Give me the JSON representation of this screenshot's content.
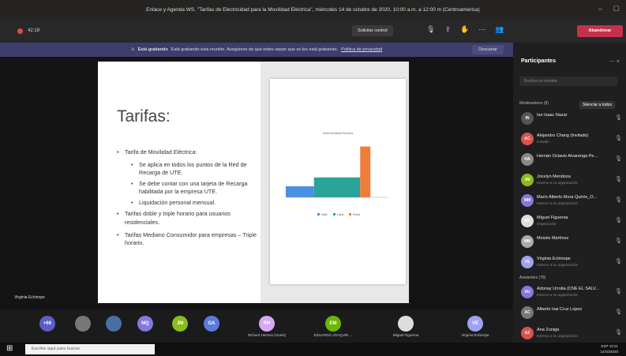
{
  "window": {
    "title": "Enlace y Agenda WS. \"Tarifas de Electricidad para la Movilidad Eléctrica\", miércoles 14 de octubre de 2020, 10:00 a.m. a 12:00 m (Centroamérica)"
  },
  "toolbar": {
    "timer": "42:19",
    "request_control": "Solicitar control",
    "leave": "Abandonar"
  },
  "banner": {
    "bold": "Está grabando",
    "text": "Está grabando esta reunión. Asegúrese de que todos sepan que se les está grabando.",
    "link": "Política de privacidad",
    "dismiss": "Descartar"
  },
  "slide": {
    "title": "Tarifas:",
    "bullets": [
      "Tarifa de Movilidad Eléctrica:",
      "Se aplica en todos los puntos de la Red de Recarga de UTE.",
      "Se debe contar con una tarjeta de Recarga habilitada por la empresa UTE.",
      "Liquidación personal mensual.",
      "Tarifas doble y triple horario para usuarios residenciales.",
      "Tarifas Mediano Consumidor para empresas – Triple horario."
    ]
  },
  "speaker_label": "Virginia Echinope",
  "chart_data": {
    "type": "bar",
    "title": "Tarifa Movilidad Eléctrica",
    "subtitle": "",
    "series": [
      {
        "name": "Valle",
        "color": "#4a90e2",
        "segment": [
          0,
          11
        ],
        "value": 1.0
      },
      {
        "name": "Llano",
        "color": "#2aa39a",
        "segment": [
          11,
          29
        ],
        "value": 1.8
      },
      {
        "name": "Punta",
        "color": "#f07c3a",
        "segment": [
          29,
          33
        ],
        "value": 4.6
      }
    ],
    "ylim": [
      0,
      5
    ],
    "xlim": [
      0,
      40
    ]
  },
  "stage_participants": [
    {
      "initials": "+66",
      "color": "#5b5fc7",
      "label": ""
    },
    {
      "initials": "",
      "color": "#777777",
      "label": ""
    },
    {
      "initials": "",
      "color": "#4a6fa5",
      "label": ""
    },
    {
      "initials": "MQ",
      "color": "#8378de",
      "label": ""
    },
    {
      "initials": "JM",
      "color": "#8cbd18",
      "label": ""
    },
    {
      "initials": "GA",
      "color": "#5c7bd9",
      "label": ""
    },
    {
      "initials": "RH",
      "color": "#d5a9f3",
      "label": "Richard Herrera (Guest)"
    },
    {
      "initials": "EM",
      "color": "#6bb700",
      "label": "EDUARDO JOAQUÍN ..."
    },
    {
      "initials": "",
      "color": "#dddddd",
      "label": "Miguel Figueroa"
    },
    {
      "initials": "VE",
      "color": "#9ea2f2",
      "label": "Virginia Echinope"
    }
  ],
  "panel": {
    "title": "Participantes",
    "invite_placeholder": "Escriba un nombre",
    "moderators_header": "Moderadores (8)",
    "mute_all": "Silenciar a todos",
    "attendees_header": "Asistentes (78)",
    "moderators": [
      {
        "initials": "IN",
        "color": "#555",
        "name": "Ian Isaac Nazar",
        "sub": ""
      },
      {
        "initials": "AC",
        "color": "#d9534f",
        "name": "Alejandro Chang (Invitado)",
        "sub": "Invitado"
      },
      {
        "initials": "HA",
        "color": "#888",
        "name": "Hernán Octavio Alvarenga Pe...",
        "sub": ""
      },
      {
        "initials": "JM",
        "color": "#8cbd18",
        "name": "Jocelyn Mendoza",
        "sub": "Externo a su organización"
      },
      {
        "initials": "MM",
        "color": "#8378de",
        "name": "Mario Alberto Mora Quirós_O...",
        "sub": "Externo a su organización"
      },
      {
        "initials": "MF",
        "color": "#ddd",
        "name": "Miguel Figueroa",
        "sub": "Organizador"
      },
      {
        "initials": "MM",
        "color": "#aaa",
        "name": "Moisés Martínez",
        "sub": ""
      },
      {
        "initials": "VE",
        "color": "#9ea2f2",
        "name": "Virginia Echinope",
        "sub": "Externo a su organización"
      }
    ],
    "attendees": [
      {
        "initials": "AU",
        "color": "#8378de",
        "name": "Adonay Urrutia (CNE EL SALV...",
        "sub": "Externo a su organización"
      },
      {
        "initials": "AC",
        "color": "#777",
        "name": "Alberto Isai Cruz Lopez",
        "sub": ""
      },
      {
        "initials": "AZ",
        "color": "#d9534f",
        "name": "Ana Zuniga",
        "sub": "Externo a su organización"
      }
    ]
  },
  "taskbar": {
    "search_placeholder": "Escribe aquí para buscar",
    "time": "10:21",
    "date": "14/10/2020",
    "lang": "ESP"
  }
}
